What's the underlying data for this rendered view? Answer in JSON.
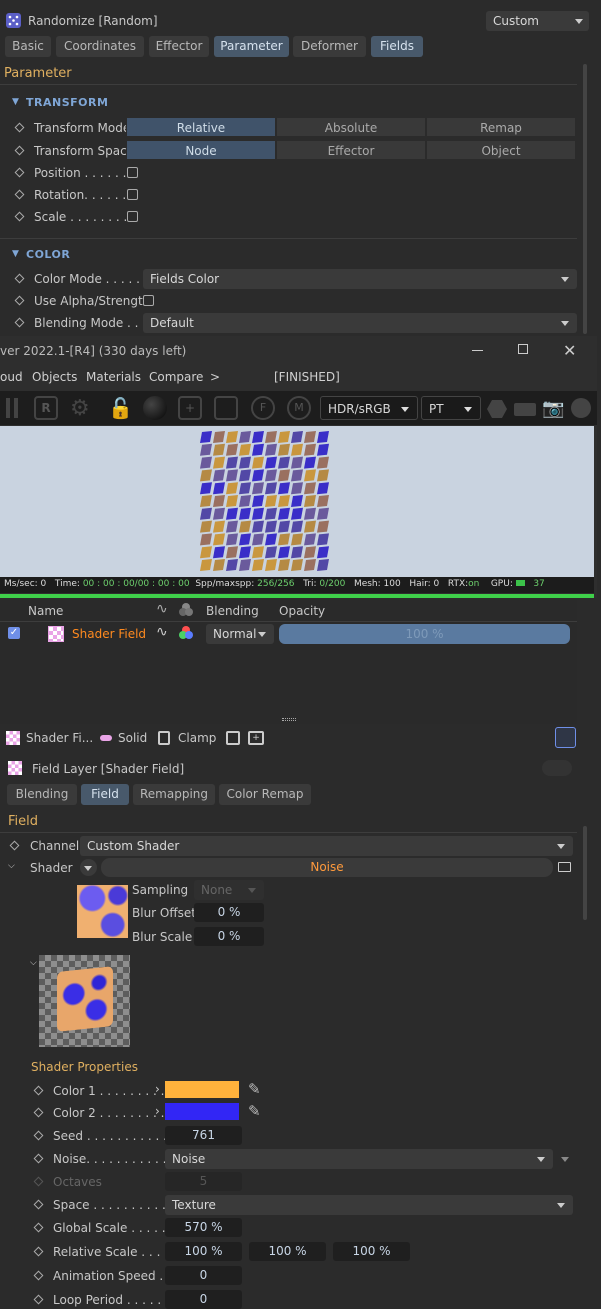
{
  "top": {
    "title": "Randomize [Random]",
    "preset": "Custom",
    "tabs": [
      "Basic",
      "Coordinates",
      "Effector",
      "Parameter",
      "Deformer",
      "Fields"
    ]
  },
  "param": {
    "heading": "Parameter",
    "transform_section": "TRANSFORM",
    "transform_mode_label": "Transform Mode",
    "transform_mode_opts": [
      "Relative",
      "Absolute",
      "Remap"
    ],
    "transform_space_label": "Transform Space",
    "transform_space_opts": [
      "Node",
      "Effector",
      "Object"
    ],
    "position": "Position . . . . . .",
    "rotation": "Rotation. . . . . .",
    "scale": "Scale . . . . . . . .",
    "color_section": "COLOR",
    "color_mode_label": "Color Mode . . . . .",
    "color_mode_value": "Fields Color",
    "use_alpha": "Use Alpha/Strength",
    "blending_mode_label": "Blending Mode . . .",
    "blending_mode_value": "Default"
  },
  "viewer": {
    "title": "ver 2022.1-[R4] (330 days left)",
    "menu": [
      "oud",
      "Objects",
      "Materials",
      "Compare",
      ">"
    ],
    "status": "[FINISHED]",
    "color_mode": "HDR/sRGB",
    "render_mode": "PT",
    "stats": {
      "ms": "Ms/sec: 0",
      "time_label": "Time:",
      "time_value": "00 : 00 : 00/00 : 00 : 00",
      "spp_label": "Spp/maxspp:",
      "spp_value": "256/256",
      "tri_label": "Tri:",
      "tri_value": "0/200",
      "mesh": "Mesh: 100",
      "hair": "Hair: 0",
      "rtx_label": "RTX:",
      "rtx_value": "on",
      "gpu_label": "GPU:",
      "gpu_value": "37"
    }
  },
  "fields_list": {
    "cols": [
      "Name",
      "Blending",
      "Opacity"
    ],
    "row": {
      "name": "Shader Field",
      "blend": "Normal",
      "opacity": "100 %"
    }
  },
  "field_toolbar": [
    "Shader Fi...",
    "Solid",
    "Clamp"
  ],
  "layer": {
    "title": "Field Layer [Shader Field]",
    "tabs": [
      "Blending",
      "Field",
      "Remapping",
      "Color Remap"
    ],
    "heading": "Field",
    "channel_label": "Channel",
    "channel_value": "Custom Shader",
    "shader_label": "Shader",
    "shader_value": "Noise",
    "sampling_label": "Sampling",
    "sampling_value": "None",
    "blur_offset_label": "Blur Offset",
    "blur_offset_value": "0 %",
    "blur_scale_label": "Blur Scale",
    "blur_scale_value": "0 %",
    "shader_props": "Shader Properties",
    "color1_label": "Color 1 . . . . . . . . .",
    "color1": "#ffb23c",
    "color2_label": "Color 2 . . . . . . . . .",
    "color2": "#3226f5",
    "seed_label": "Seed . . . . . . . . . . . .",
    "seed_value": "761",
    "noise_label": "Noise. . . . . . . . . . .",
    "noise_value": "Noise",
    "octaves_label": "Octaves",
    "octaves_value": "5",
    "space_label": "Space . . . . . . . . . . .",
    "space_value": "Texture",
    "gscale_label": "Global Scale . . . . . .",
    "gscale_value": "570 %",
    "rscale_label": "Relative Scale . . . . .",
    "rscale_values": [
      "100 %",
      "100 %",
      "100 %"
    ],
    "anim_label": "Animation Speed . .",
    "anim_value": "0",
    "loop_label": "Loop Period . . . . . .",
    "loop_value": "0"
  }
}
